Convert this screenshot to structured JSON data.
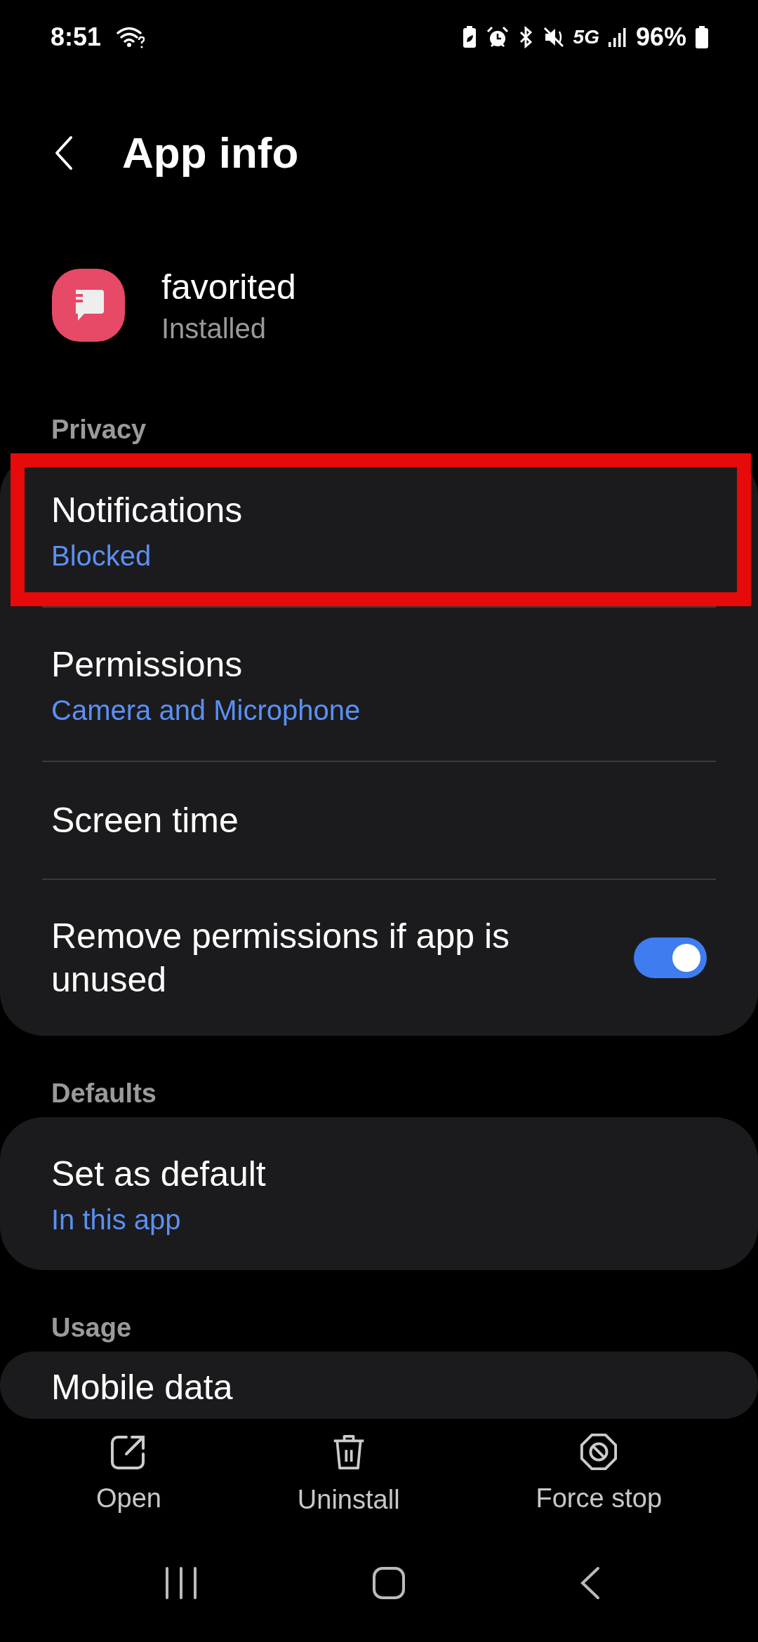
{
  "status_bar": {
    "time": "8:51",
    "network": "5G",
    "battery": "96%"
  },
  "header": {
    "title": "App info"
  },
  "app": {
    "name": "favorited",
    "status": "Installed"
  },
  "sections": [
    {
      "label": "Privacy",
      "items": [
        {
          "kind": "link",
          "title": "Notifications",
          "subtitle": "Blocked",
          "highlighted": true
        },
        {
          "kind": "link",
          "title": "Permissions",
          "subtitle": "Camera and Microphone",
          "highlighted": false
        },
        {
          "kind": "link",
          "title": "Screen time",
          "highlighted": false
        },
        {
          "kind": "toggle",
          "title": "Remove permissions if app is unused",
          "on": true,
          "highlighted": false
        }
      ]
    },
    {
      "label": "Defaults",
      "items": [
        {
          "kind": "link",
          "title": "Set as default",
          "subtitle": "In this app",
          "highlighted": false
        }
      ]
    },
    {
      "label": "Usage",
      "items": [
        {
          "kind": "link",
          "title": "Mobile data",
          "highlighted": false
        }
      ]
    }
  ],
  "actions": [
    {
      "kind": "open",
      "label": "Open"
    },
    {
      "kind": "uninstall",
      "label": "Uninstall"
    },
    {
      "kind": "stop",
      "label": "Force stop"
    }
  ]
}
